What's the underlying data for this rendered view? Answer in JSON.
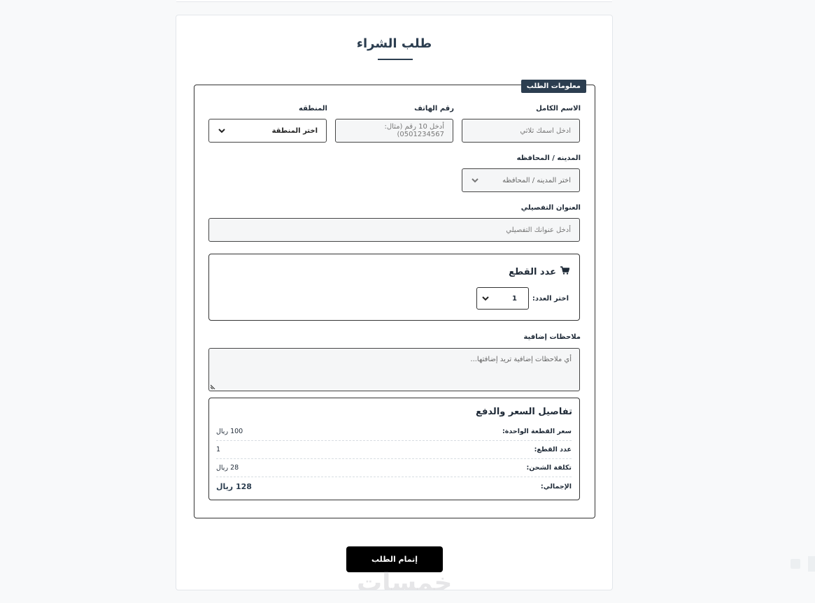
{
  "form": {
    "title": "طلب الشراء",
    "legend": "معلومات الطلب",
    "fields": {
      "full_name": {
        "label": "الاسم الكامل",
        "placeholder": "ادخل اسمك ثلاثي"
      },
      "phone": {
        "label": "رقم الهاتف",
        "placeholder": "أدخل 10 رقم (مثال: 0501234567)"
      },
      "region": {
        "label": "المنطقه",
        "value": "اختر المنطقة"
      },
      "city": {
        "label": "المدينه / المحافظه",
        "value": "اختر المدينه / المحافظه"
      },
      "address": {
        "label": "العنوان التفصيلي",
        "placeholder": "أدخل عنوانك التفصيلي"
      },
      "notes": {
        "label": "ملاحظات إضافية",
        "placeholder": "أي ملاحظات إضافية تريد إضافتها..."
      }
    },
    "quantity": {
      "title": "عدد القطع",
      "select_label": "اختر العدد:",
      "value": "1",
      "icon": "cart-icon"
    },
    "pricing": {
      "title": "تفاصيل السعر والدفع",
      "rows": [
        {
          "label": "سعر القطعة الواحدة:",
          "value": "100 ريال"
        },
        {
          "label": "عدد القطع:",
          "value": "1"
        },
        {
          "label": "تكلفة الشحن:",
          "value": "28 ريال"
        },
        {
          "label": "الإجمالي:",
          "value": "128 ريال"
        }
      ]
    },
    "submit_label": "إتمام الطلب",
    "watermark": "خمسات"
  },
  "colors": {
    "accent": "#2c3e50",
    "button": "#000000",
    "border": "#333333"
  }
}
